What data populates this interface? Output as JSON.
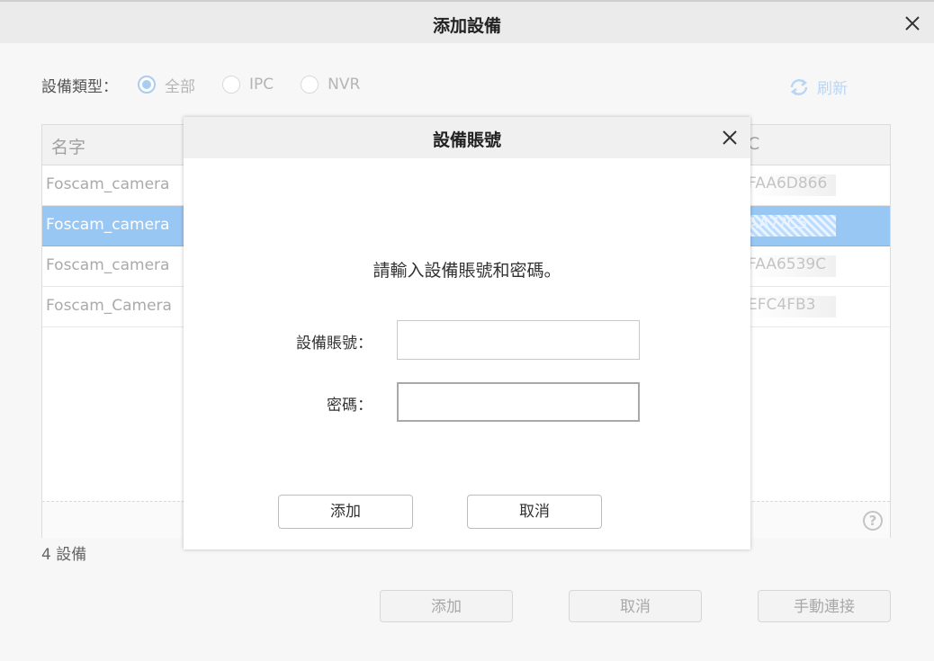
{
  "outer": {
    "title": "添加設備",
    "filter": {
      "label": "設備類型：",
      "options": [
        {
          "label": "全部",
          "checked": true
        },
        {
          "label": "IPC",
          "checked": false
        },
        {
          "label": "NVR",
          "checked": false
        }
      ]
    },
    "refresh_label": "刷新",
    "table": {
      "columns": [
        "名字",
        "C"
      ],
      "rows": [
        {
          "name": "Foscam_camera",
          "mac": "FAA6D866",
          "selected": false
        },
        {
          "name": "Foscam_camera",
          "mac": "AA7?C5",
          "selected": true
        },
        {
          "name": "Foscam_camera",
          "mac": "FAA6539C",
          "selected": false
        },
        {
          "name": "Foscam_Camera",
          "mac": "EFC4FB3",
          "selected": false
        }
      ]
    },
    "device_count": "4 設備",
    "buttons": {
      "add": "添加",
      "cancel": "取消",
      "manual": "手動連接"
    }
  },
  "modal": {
    "title": "設備賬號",
    "prompt": "請輸入設備賬號和密碼。",
    "username_label": "設備賬號：",
    "username_value": "",
    "password_label": "密碼：",
    "password_value": "",
    "add_button": "添加",
    "cancel_button": "取消"
  },
  "colors": {
    "selected_row": "#99c7f3",
    "radio_accent": "#a9cdf0",
    "refresh_accent": "#b8d6f4"
  }
}
